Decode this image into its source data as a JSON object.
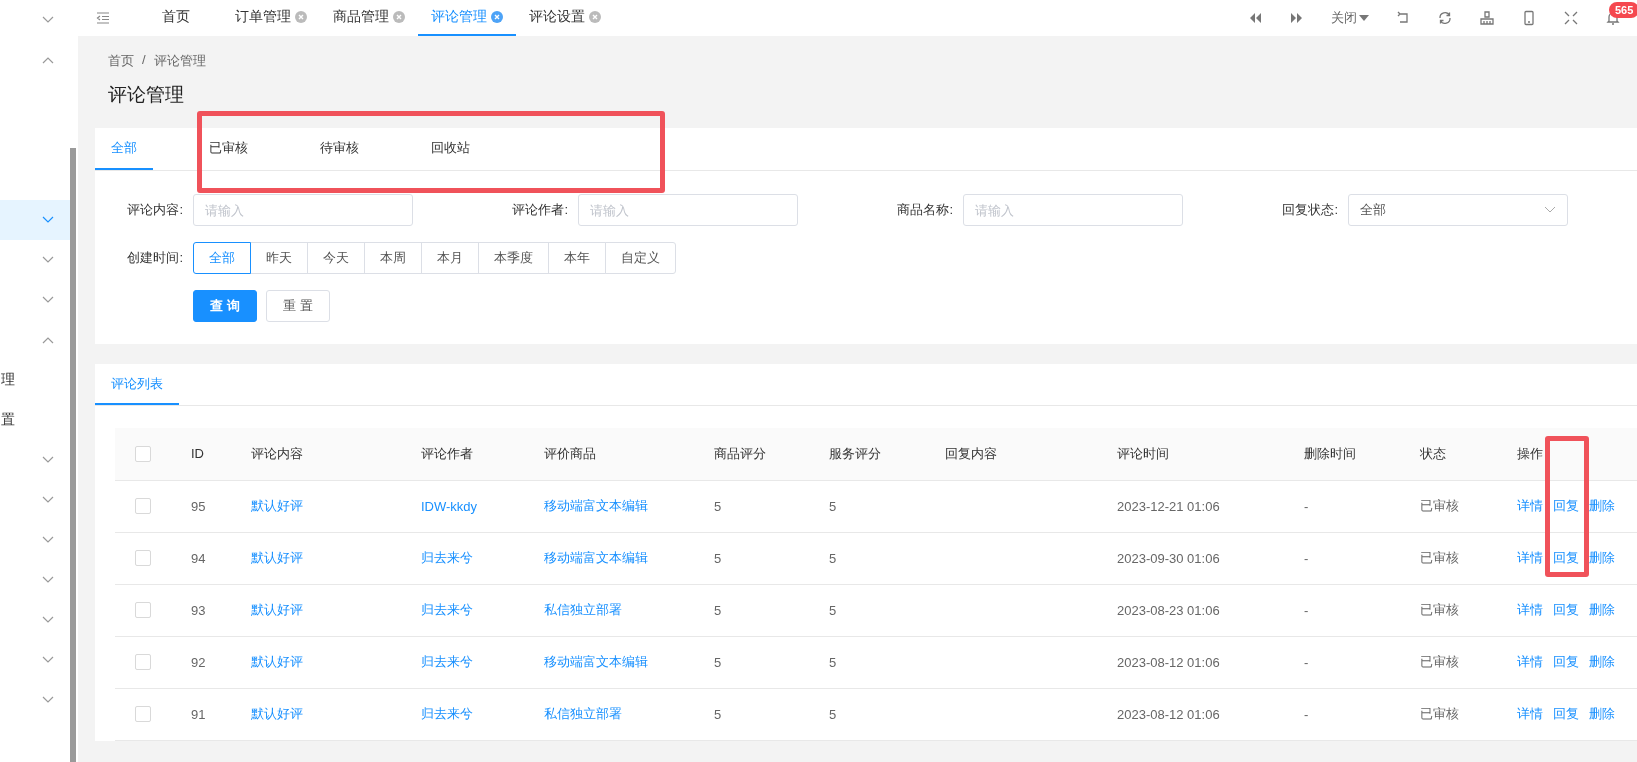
{
  "sidebar": {
    "items": [
      {
        "kind": "group",
        "expanded": false,
        "selected": false
      },
      {
        "kind": "group",
        "expanded": true,
        "selected": false
      },
      {
        "kind": "group",
        "expanded": false,
        "selected": true
      },
      {
        "kind": "group",
        "expanded": false,
        "selected": false
      },
      {
        "kind": "group",
        "expanded": false,
        "selected": false
      },
      {
        "kind": "group",
        "expanded": true,
        "selected": false
      },
      {
        "kind": "link",
        "label": "理",
        "selected": false
      },
      {
        "kind": "link",
        "label": "置",
        "selected": false
      },
      {
        "kind": "group",
        "expanded": false,
        "selected": false
      },
      {
        "kind": "group",
        "expanded": false,
        "selected": false
      },
      {
        "kind": "group",
        "expanded": false,
        "selected": false
      },
      {
        "kind": "group",
        "expanded": false,
        "selected": false
      },
      {
        "kind": "group",
        "expanded": false,
        "selected": false
      },
      {
        "kind": "group",
        "expanded": false,
        "selected": false
      },
      {
        "kind": "group",
        "expanded": false,
        "selected": false
      }
    ]
  },
  "top_tabs": [
    {
      "label": "首页",
      "closable": false,
      "selected": false
    },
    {
      "label": "订单管理",
      "closable": true,
      "selected": false
    },
    {
      "label": "商品管理",
      "closable": true,
      "selected": false
    },
    {
      "label": "评论管理",
      "closable": true,
      "selected": true
    },
    {
      "label": "评论设置",
      "closable": true,
      "selected": false
    }
  ],
  "toolbar": {
    "close_menu": "关闭",
    "notification_count": "565"
  },
  "breadcrumb": {
    "items": [
      "首页",
      "评论管理"
    ],
    "separator": "/"
  },
  "page_title": "评论管理",
  "status_tabs": [
    {
      "label": "全部",
      "selected": true
    },
    {
      "label": "已审核",
      "selected": false
    },
    {
      "label": "待审核",
      "selected": false
    },
    {
      "label": "回收站",
      "selected": false
    }
  ],
  "filters": [
    {
      "kind": "input",
      "label": "评论内容:",
      "placeholder": "请输入"
    },
    {
      "kind": "input",
      "label": "评论作者:",
      "placeholder": "请输入"
    },
    {
      "kind": "input",
      "label": "商品名称:",
      "placeholder": "请输入"
    },
    {
      "kind": "select",
      "label": "回复状态:",
      "value": "全部"
    }
  ],
  "date_filter": {
    "label": "创建时间:",
    "options": [
      {
        "label": "全部",
        "selected": true
      },
      {
        "label": "昨天",
        "selected": false
      },
      {
        "label": "今天",
        "selected": false
      },
      {
        "label": "本周",
        "selected": false
      },
      {
        "label": "本月",
        "selected": false
      },
      {
        "label": "本季度",
        "selected": false
      },
      {
        "label": "本年",
        "selected": false
      },
      {
        "label": "自定义",
        "selected": false
      }
    ]
  },
  "buttons": [
    {
      "label": "查 询",
      "kind": "primary"
    },
    {
      "label": "重 置",
      "kind": "default"
    }
  ],
  "list_tab": {
    "label": "评论列表",
    "selected": true
  },
  "table": {
    "select_all_checked": false,
    "columns": [
      "ID",
      "评论内容",
      "评论作者",
      "评价商品",
      "商品评分",
      "服务评分",
      "回复内容",
      "评论时间",
      "删除时间",
      "状态",
      "操作"
    ],
    "rows": [
      {
        "checked": false,
        "id": "95",
        "content": "默认好评",
        "author": "IDW-kkdy",
        "product": "移动端富文本编辑",
        "product_score": "5",
        "service_score": "5",
        "time": "2023-12-21 01:06",
        "delete_time": "-",
        "status": "已审核",
        "actions": [
          "详情",
          "回复",
          "删除"
        ]
      },
      {
        "checked": false,
        "id": "94",
        "content": "默认好评",
        "author": "归去来兮",
        "product": "移动端富文本编辑",
        "product_score": "5",
        "service_score": "5",
        "time": "2023-09-30 01:06",
        "delete_time": "-",
        "status": "已审核",
        "actions": [
          "详情",
          "回复",
          "删除"
        ]
      },
      {
        "checked": false,
        "id": "93",
        "content": "默认好评",
        "author": "归去来兮",
        "product": "私信独立部署",
        "product_score": "5",
        "service_score": "5",
        "time": "2023-08-23 01:06",
        "delete_time": "-",
        "status": "已审核",
        "actions": [
          "详情",
          "回复",
          "删除"
        ]
      },
      {
        "checked": false,
        "id": "92",
        "content": "默认好评",
        "author": "归去来兮",
        "product": "移动端富文本编辑",
        "product_score": "5",
        "service_score": "5",
        "time": "2023-08-12 01:06",
        "delete_time": "-",
        "status": "已审核",
        "actions": [
          "详情",
          "回复",
          "删除"
        ]
      },
      {
        "checked": false,
        "id": "91",
        "content": "默认好评",
        "author": "归去来兮",
        "product": "私信独立部署",
        "product_score": "5",
        "service_score": "5",
        "time": "2023-08-12 01:06",
        "delete_time": "-",
        "status": "已审核",
        "actions": [
          "详情",
          "回复",
          "删除"
        ]
      }
    ]
  },
  "annotations": [
    {
      "kind": "box"
    },
    {
      "kind": "box"
    }
  ]
}
